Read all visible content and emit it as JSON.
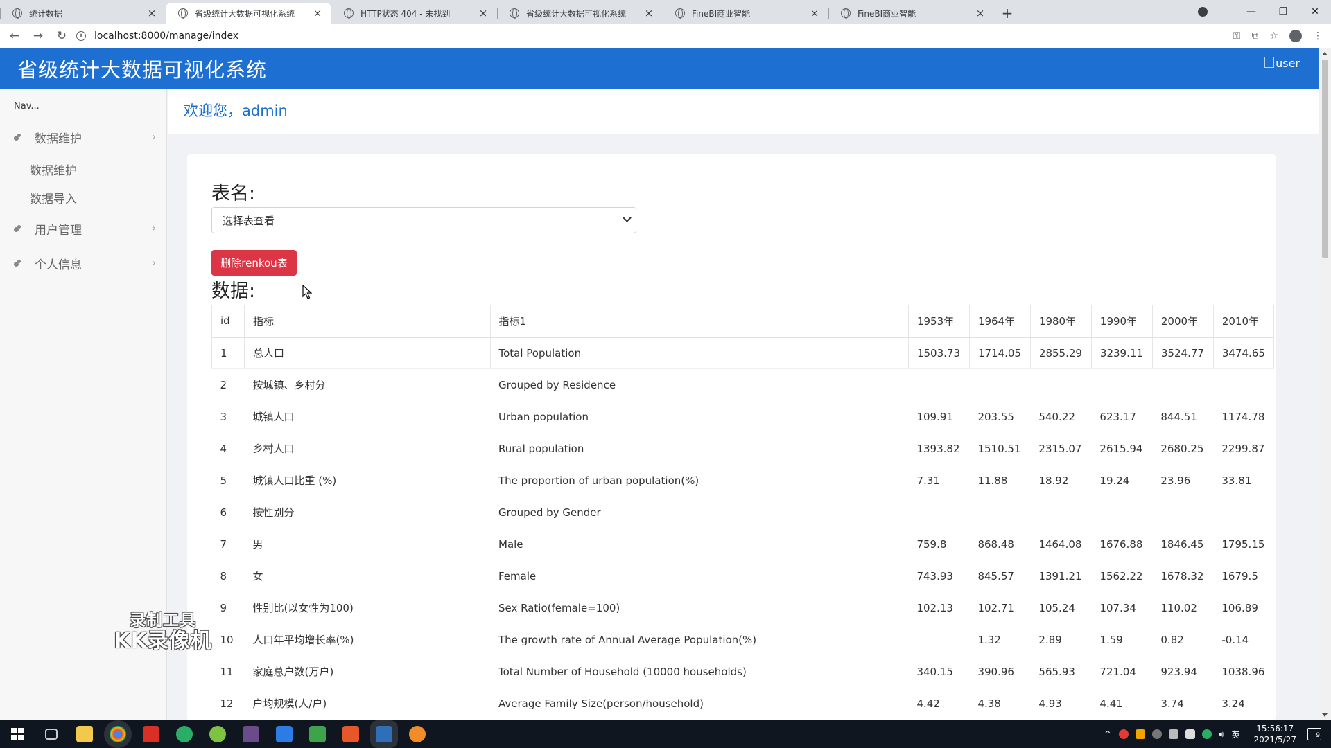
{
  "browser": {
    "tabs": [
      {
        "title": "统计数据",
        "active": false
      },
      {
        "title": "省级统计大数据可视化系统",
        "active": true
      },
      {
        "title": "HTTP状态 404 - 未找到",
        "active": false
      },
      {
        "title": "省级统计大数据可视化系统",
        "active": false
      },
      {
        "title": "FineBI商业智能",
        "active": false
      },
      {
        "title": "FineBI商业智能",
        "active": false
      }
    ],
    "url": "localhost:8000/manage/index"
  },
  "header": {
    "title": "省级统计大数据可视化系统",
    "user_alt": "user"
  },
  "sidebar": {
    "caption": "Nav...",
    "items": [
      {
        "label": "数据维护",
        "children": [
          "数据维护",
          "数据导入"
        ]
      },
      {
        "label": "用户管理"
      },
      {
        "label": "个人信息"
      }
    ]
  },
  "welcome": "欢迎您，admin",
  "form": {
    "table_label": "表名:",
    "select_value": "选择表查看",
    "delete_button": "删除renkou表",
    "data_label": "数据:"
  },
  "table": {
    "columns": [
      "id",
      "指标",
      "指标1",
      "1953年",
      "1964年",
      "1980年",
      "1990年",
      "2000年",
      "2010年"
    ],
    "rows": [
      [
        "1",
        "总人口",
        "Total Population",
        "1503.73",
        "1714.05",
        "2855.29",
        "3239.11",
        "3524.77",
        "3474.65"
      ],
      [
        "2",
        "按城镇、乡村分",
        "Grouped by Residence",
        "",
        "",
        "",
        "",
        "",
        ""
      ],
      [
        "3",
        "城镇人口",
        "Urban population",
        "109.91",
        "203.55",
        "540.22",
        "623.17",
        "844.51",
        "1174.78"
      ],
      [
        "4",
        "乡村人口",
        "Rural population",
        "1393.82",
        "1510.51",
        "2315.07",
        "2615.94",
        "2680.25",
        "2299.87"
      ],
      [
        "5",
        "城镇人口比重 (%)",
        "The proportion of urban population(%)",
        "7.31",
        "11.88",
        "18.92",
        "19.24",
        "23.96",
        "33.81"
      ],
      [
        "6",
        "按性别分",
        "Grouped by Gender",
        "",
        "",
        "",
        "",
        "",
        ""
      ],
      [
        "7",
        "男",
        "Male",
        "759.8",
        "868.48",
        "1464.08",
        "1676.88",
        "1846.45",
        "1795.15"
      ],
      [
        "8",
        "女",
        "Female",
        "743.93",
        "845.57",
        "1391.21",
        "1562.22",
        "1678.32",
        "1679.5"
      ],
      [
        "9",
        "性别比(以女性为100)",
        "Sex Ratio(female=100)",
        "102.13",
        "102.71",
        "105.24",
        "107.34",
        "110.02",
        "106.89"
      ],
      [
        "10",
        "人口年平均增长率(%)",
        "The growth rate of Annual Average Population(%)",
        "",
        "1.32",
        "2.89",
        "1.59",
        "0.82",
        "-0.14"
      ],
      [
        "11",
        "家庭总户数(万户)",
        "Total Number of Household (10000 households)",
        "340.15",
        "390.96",
        "565.93",
        "721.04",
        "923.94",
        "1038.96"
      ],
      [
        "12",
        "户均规模(人/户)",
        "Average Family Size(person/household)",
        "4.42",
        "4.38",
        "4.93",
        "4.41",
        "3.74",
        "3.24"
      ]
    ]
  },
  "watermark": {
    "line1": "录制工具",
    "line2": "KK录像机"
  },
  "taskbar": {
    "time": "15:56:17",
    "date": "2021/5/27",
    "ime": "英",
    "notifications": "9"
  },
  "colors": {
    "brand": "#1d6fd2",
    "danger": "#dc3545"
  }
}
